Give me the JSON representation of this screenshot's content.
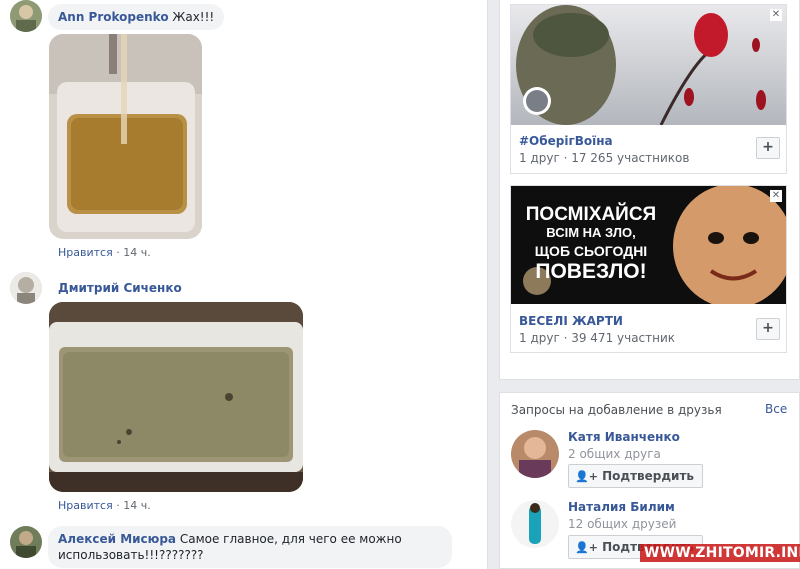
{
  "comments": [
    {
      "author": "Ann Prokopenko",
      "text": "Жах!!!",
      "like_label": "Нравится",
      "time": "14 ч."
    },
    {
      "author": "Дмитрий Сиченко",
      "text": "",
      "like_label": "Нравится",
      "time": "14 ч."
    },
    {
      "author": "Алексей Мисюра",
      "text": "Самое главное, для чего ее можно использовать!!!???????"
    }
  ],
  "groups": [
    {
      "name": "#ОберігВоїна",
      "members": "1 друг · 17 265 участников",
      "add": "+"
    },
    {
      "name": "ВЕСЕЛІ ЖАРТИ",
      "members": "1 друг · 39 471 участник",
      "add": "+",
      "banner_line1": "ПОСМІХАЙСЯ",
      "banner_line2": "ВСІМ НА ЗЛО,",
      "banner_line3": "ЩОБ СЬОГОДНІ",
      "banner_line4": "ПОВЕЗЛО!"
    }
  ],
  "friend_requests": {
    "title": "Запросы на добавление в друзья",
    "see_all": "Все",
    "items": [
      {
        "name": "Катя Иванченко",
        "mutual": "2 общих друга",
        "confirm": "Подтвердить"
      },
      {
        "name": "Наталия Билим",
        "mutual": "12 общих друзей",
        "confirm": "Подтвердить"
      }
    ]
  },
  "close_glyph": "✕",
  "watermark": "WWW.ZHITOMIR.INFO"
}
